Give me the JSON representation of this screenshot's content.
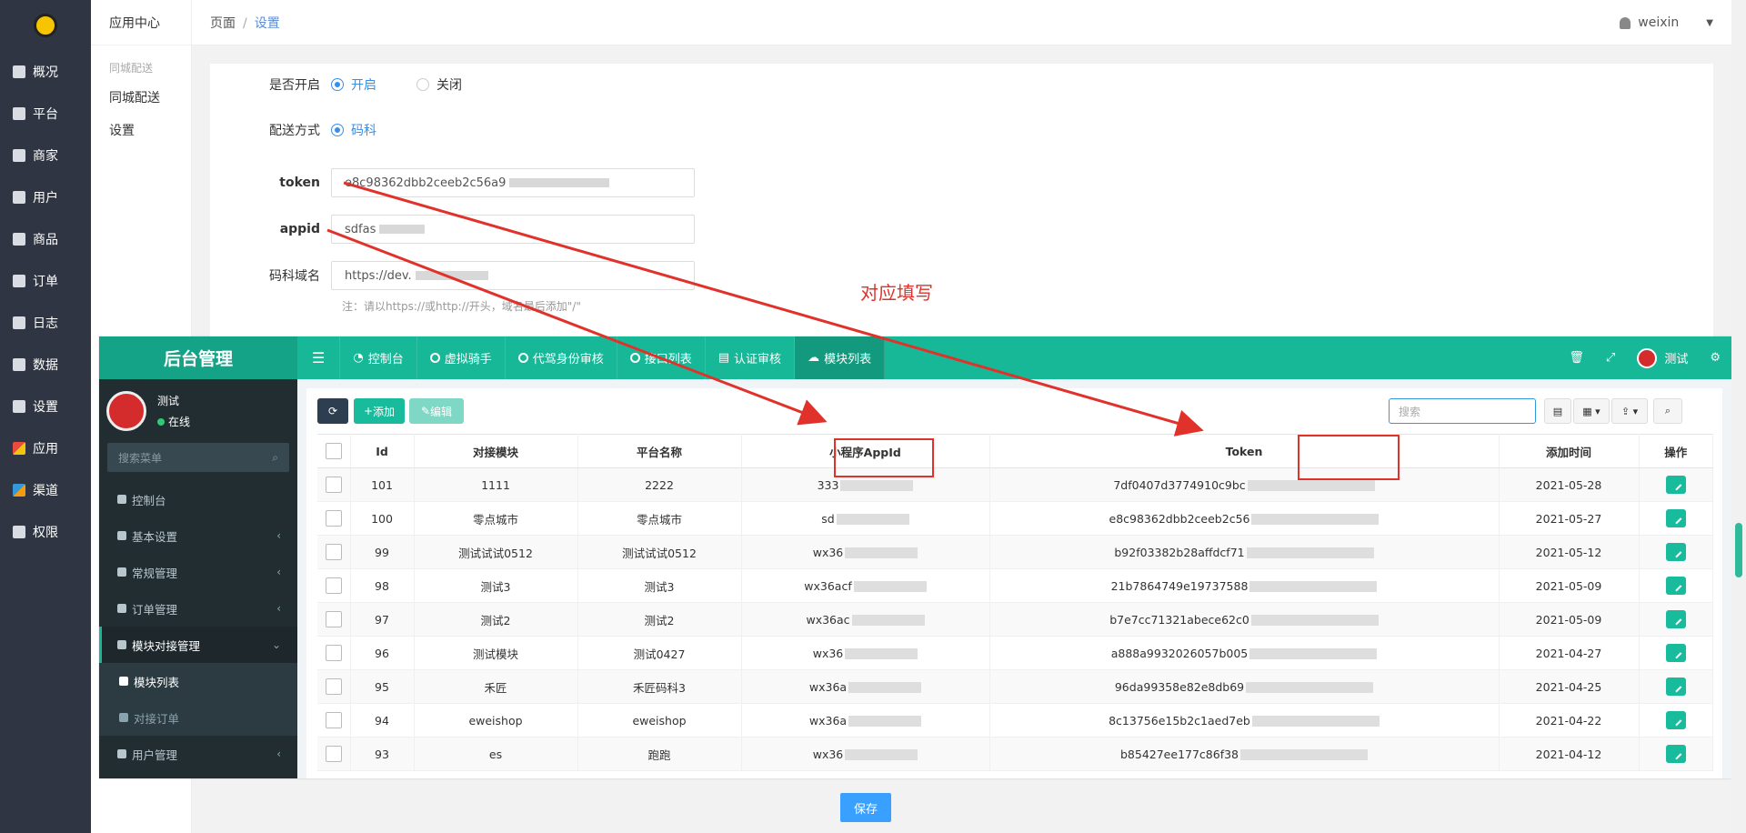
{
  "leftnav": {
    "items": [
      {
        "label": "概况",
        "icon": "dashboard-icon"
      },
      {
        "label": "平台",
        "icon": "monitor-icon"
      },
      {
        "label": "商家",
        "icon": "shop-icon"
      },
      {
        "label": "用户",
        "icon": "user-icon"
      },
      {
        "label": "商品",
        "icon": "goods-icon"
      },
      {
        "label": "订单",
        "icon": "order-icon"
      },
      {
        "label": "日志",
        "icon": "log-icon"
      },
      {
        "label": "数据",
        "icon": "chart-icon"
      },
      {
        "label": "设置",
        "icon": "gear-icon"
      },
      {
        "label": "应用",
        "icon": "apps-icon"
      },
      {
        "label": "渠道",
        "icon": "cube-icon"
      },
      {
        "label": "权限",
        "icon": "lock-icon"
      }
    ]
  },
  "subnav": {
    "title": "应用中心",
    "group": "同城配送",
    "items": [
      "同城配送",
      "设置"
    ]
  },
  "header": {
    "crumb_root": "页面",
    "crumb_sep": "/",
    "crumb_current": "设置",
    "username": "weixin"
  },
  "form": {
    "enable_label": "是否开启",
    "enable_on": "开启",
    "enable_off": "关闭",
    "method_label": "配送方式",
    "method_value": "码科",
    "token_label": "token",
    "token_value": "e8c98362dbb2ceeb2c56a9",
    "appid_label": "appid",
    "appid_value": "sdfas",
    "domain_label": "码科域名",
    "domain_value": "https://dev.",
    "hint": "注：请以https://或http://开头，域名最后添加\"/\""
  },
  "annotation": "对应填写",
  "overlay": {
    "brand": "后台管理",
    "tabs": [
      {
        "label": "控制台"
      },
      {
        "label": "虚拟骑手"
      },
      {
        "label": "代驾身份审核"
      },
      {
        "label": "接口列表"
      },
      {
        "label": "认证审核"
      },
      {
        "label": "模块列表"
      }
    ],
    "user": "测试",
    "sidebar": {
      "name": "测试",
      "status": "在线",
      "search_placeholder": "搜索菜单",
      "items": [
        {
          "label": "控制台"
        },
        {
          "label": "基本设置"
        },
        {
          "label": "常规管理"
        },
        {
          "label": "订单管理"
        },
        {
          "label": "模块对接管理"
        },
        {
          "label": "模块列表"
        },
        {
          "label": "对接订单"
        },
        {
          "label": "用户管理"
        }
      ]
    },
    "toolbar": {
      "add": "添加",
      "edit": "编辑",
      "search_placeholder": "搜索"
    },
    "table": {
      "headers": [
        "Id",
        "对接模块",
        "平台名称",
        "小程序AppId",
        "Token",
        "添加时间",
        "操作"
      ],
      "rows": [
        {
          "id": "101",
          "module": "1111",
          "platform": "2222",
          "appid": "333",
          "token": "7df0407d3774910c9bc",
          "date": "2021-05-28"
        },
        {
          "id": "100",
          "module": "零点城市",
          "platform": "零点城市",
          "appid": "sd",
          "token": "e8c98362dbb2ceeb2c56",
          "date": "2021-05-27"
        },
        {
          "id": "99",
          "module": "测试试试0512",
          "platform": "测试试试0512",
          "appid": "wx36",
          "token": "b92f03382b28affdcf71",
          "date": "2021-05-12"
        },
        {
          "id": "98",
          "module": "测试3",
          "platform": "测试3",
          "appid": "wx36acf",
          "token": "21b7864749e19737588",
          "date": "2021-05-09"
        },
        {
          "id": "97",
          "module": "测试2",
          "platform": "测试2",
          "appid": "wx36ac",
          "token": "b7e7cc71321abece62c0",
          "date": "2021-05-09"
        },
        {
          "id": "96",
          "module": "测试模块",
          "platform": "测试0427",
          "appid": "wx36",
          "token": "a888a9932026057b005",
          "date": "2021-04-27"
        },
        {
          "id": "95",
          "module": "禾匠",
          "platform": "禾匠码科3",
          "appid": "wx36a",
          "token": "96da99358e82e8db69",
          "date": "2021-04-25"
        },
        {
          "id": "94",
          "module": "eweishop",
          "platform": "eweishop",
          "appid": "wx36a",
          "token": "8c13756e15b2c1aed7eb",
          "date": "2021-04-22"
        },
        {
          "id": "93",
          "module": "es",
          "platform": "跑跑",
          "appid": "wx36",
          "token": "b85427ee177c86f38",
          "date": "2021-04-12"
        }
      ]
    }
  },
  "save": "保存",
  "colors": {
    "accent_green": "#17b897",
    "highlight_red": "#e0322b",
    "link_blue": "#3a8ee6"
  }
}
